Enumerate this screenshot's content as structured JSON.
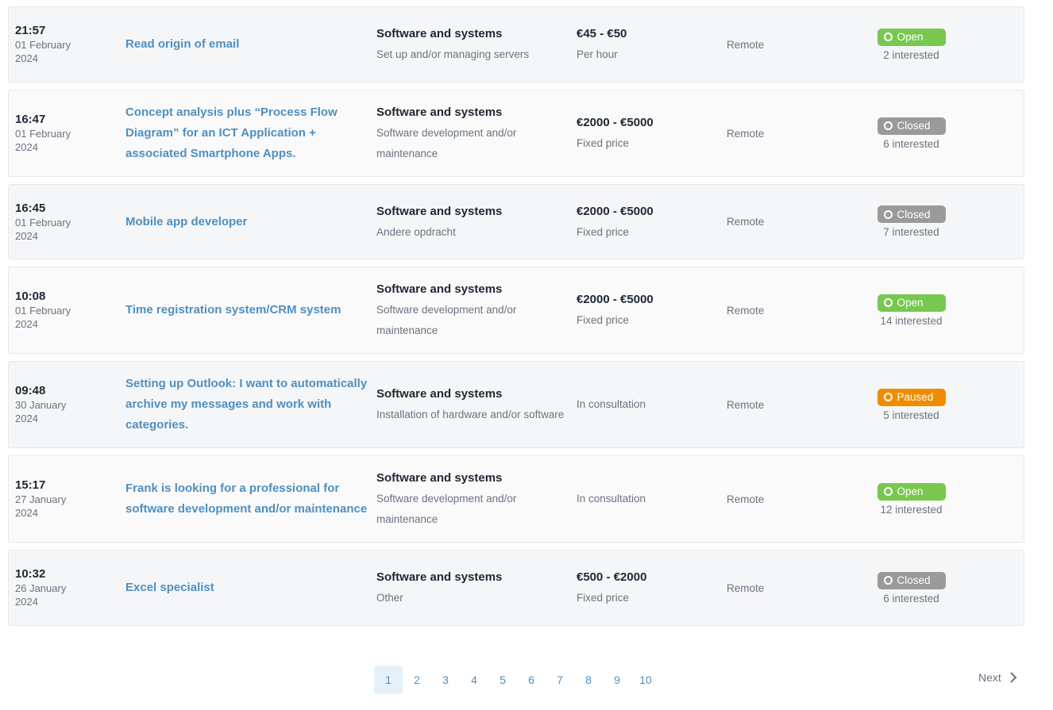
{
  "jobs": [
    {
      "time": "21:57",
      "date": "01 February 2024",
      "title": "Read origin of email",
      "category": "Software and systems",
      "subcategory": "Set up and/or managing servers",
      "price": "€45 - €50",
      "price_type": "Per hour",
      "location": "Remote",
      "status": "Open",
      "interested": "2 interested"
    },
    {
      "time": "16:47",
      "date": "01 February 2024",
      "title": "Concept analysis plus “Process Flow Diagram” for an ICT Application + associated Smartphone Apps.",
      "category": "Software and systems",
      "subcategory": "Software development and/or maintenance",
      "price": "€2000 - €5000",
      "price_type": "Fixed price",
      "location": "Remote",
      "status": "Closed",
      "interested": "6 interested"
    },
    {
      "time": "16:45",
      "date": "01 February 2024",
      "title": "Mobile app developer",
      "category": "Software and systems",
      "subcategory": "Andere opdracht",
      "price": "€2000 - €5000",
      "price_type": "Fixed price",
      "location": "Remote",
      "status": "Closed",
      "interested": "7 interested"
    },
    {
      "time": "10:08",
      "date": "01 February 2024",
      "title": "Time registration system/CRM system",
      "category": "Software and systems",
      "subcategory": "Software development and/or maintenance",
      "price": "€2000 - €5000",
      "price_type": "Fixed price",
      "location": "Remote",
      "status": "Open",
      "interested": "14 interested"
    },
    {
      "time": "09:48",
      "date": "30 January 2024",
      "title": "Setting up Outlook: I want to automatically archive my messages and work with categories.",
      "category": "Software and systems",
      "subcategory": "Installation of hardware and/or software",
      "price": "",
      "price_type": "In consultation",
      "location": "Remote",
      "status": "Paused",
      "interested": "5 interested"
    },
    {
      "time": "15:17",
      "date": "27 January 2024",
      "title": "Frank is looking for a professional for software development and/or maintenance",
      "category": "Software and systems",
      "subcategory": "Software development and/or maintenance",
      "price": "",
      "price_type": "In consultation",
      "location": "Remote",
      "status": "Open",
      "interested": "12 interested"
    },
    {
      "time": "10:32",
      "date": "26 January 2024",
      "title": "Excel specialist",
      "category": "Software and systems",
      "subcategory": "Other",
      "price": "€500 - €2000",
      "price_type": "Fixed price",
      "location": "Remote",
      "status": "Closed",
      "interested": "6 interested"
    }
  ],
  "pagination": {
    "pages": [
      "1",
      "2",
      "3",
      "4",
      "5",
      "6",
      "7",
      "8",
      "9",
      "10"
    ],
    "current": "1",
    "next_label": "Next",
    "next_icon": "chevron-right-icon"
  },
  "colors": {
    "open": "#78c850",
    "closed": "#9a9a9a",
    "paused": "#f08c00",
    "link": "#4f8fc0"
  }
}
